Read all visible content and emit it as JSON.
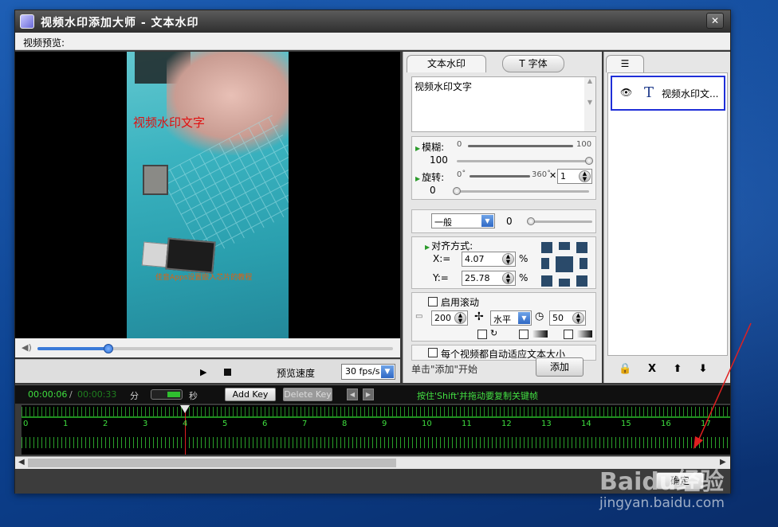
{
  "window": {
    "title": "视频水印添加大师 - 文本水印",
    "close_label": "✕"
  },
  "menu": {
    "preview_label": "视频预览:"
  },
  "video": {
    "watermark_text": "视频水印文字",
    "small_overlay_text": "佳音Apps设置嵌入芯片的教程",
    "seek_progress_pct": 20
  },
  "controls": {
    "speed_label": "预览速度",
    "fps_value": "30 fps/s"
  },
  "props": {
    "tab_text": "文本水印",
    "tab_font": "T 字体",
    "textarea_value": "视频水印文字",
    "blur": {
      "label": "模糊:",
      "min": "0",
      "max": "100",
      "value": "100",
      "level_pct": 100
    },
    "rotate": {
      "label": "旋转:",
      "min": "0˚",
      "max": "360˚",
      "value": "0",
      "multiplier_symbol": "✕",
      "multiplier": "1",
      "level_pct": 0
    },
    "blend": {
      "select": "一般",
      "value": "0"
    },
    "align": {
      "label": "对齐方式:",
      "x_label": "X:=",
      "x_value": "4.07",
      "y_label": "Y:=",
      "y_value": "25.78",
      "unit": "%"
    },
    "scroll": {
      "label": "启用滚动",
      "width_value": "200",
      "direction": "水平",
      "speed_value": "50"
    },
    "auto_fit_label": "每个视频都自动适应文本大小",
    "hint": "单击\"添加\"开始",
    "add_button": "添加"
  },
  "layers": {
    "items": [
      {
        "name": "视频水印文..."
      }
    ],
    "tools": [
      "🔒",
      "X",
      "⬆",
      "⬇"
    ]
  },
  "timeline": {
    "current_time": "00:00:06",
    "separator": "/",
    "total_time": "00:00:33",
    "unit_min": "分",
    "unit_sec": "秒",
    "add_key": "Add Key",
    "delete_key": "Delete Key",
    "tip": "按住'Shift'并拖动要复制关键帧",
    "second_marks": [
      "0",
      "1",
      "2",
      "3",
      "4",
      "5",
      "6",
      "7",
      "8",
      "9",
      "10",
      "11",
      "12",
      "13",
      "14",
      "15",
      "16",
      "17"
    ]
  },
  "footer": {
    "ok_label": "确定"
  },
  "watermark_brand": {
    "logo": "Baidu经验",
    "url": "jingyan.baidu.com"
  },
  "colors": {
    "accent_blue": "#1f2fd8",
    "timeline_green": "#3fdf3f",
    "watermark_red": "#e01010"
  }
}
